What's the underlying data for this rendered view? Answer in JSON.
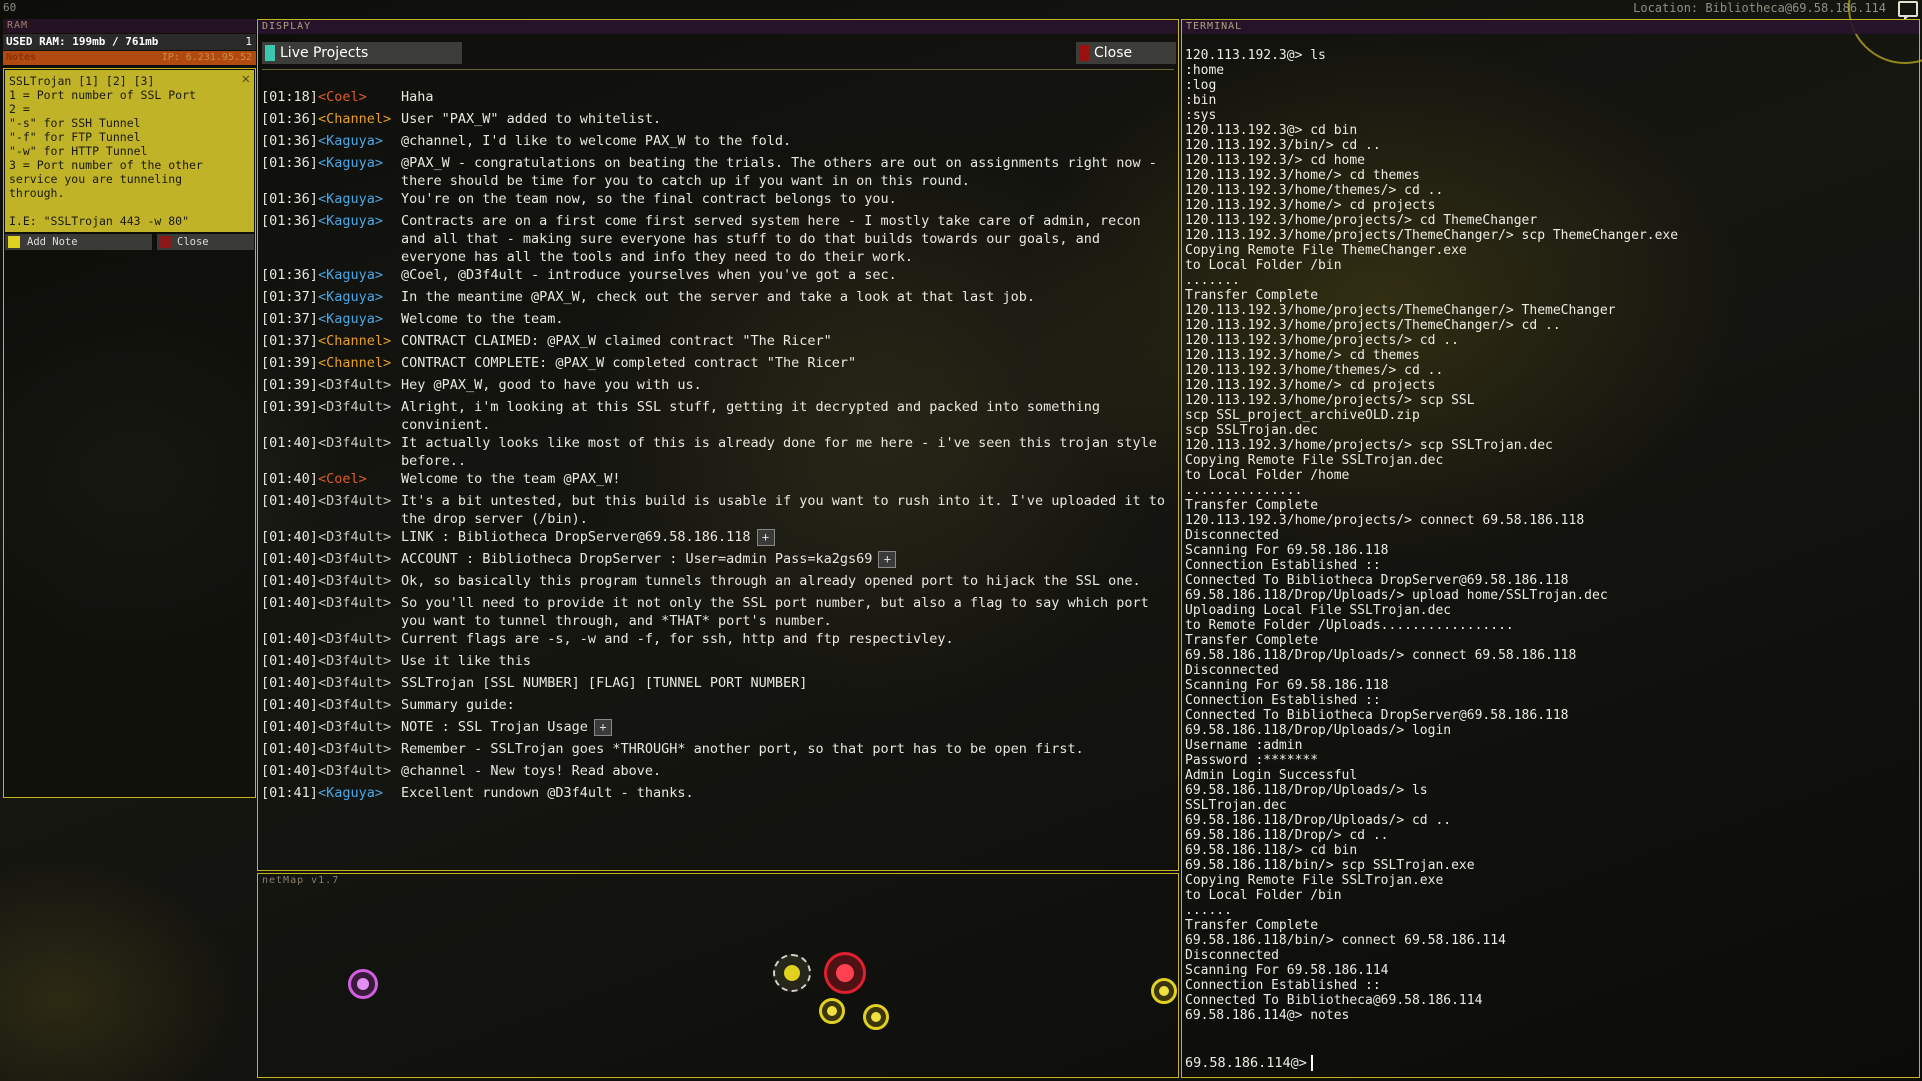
{
  "top": {
    "fps": "60",
    "location": "Location: Bibliotheca@69.58.186.114"
  },
  "ram": {
    "title": "RAM",
    "used_label": "USED RAM: 199mb / 761mb",
    "count": "1",
    "notes_label": "Notes",
    "ip": "IP: 6.231.95.52"
  },
  "note": {
    "lines": [
      "SSLTrojan [1] [2] [3]",
      "1 = Port number of SSL Port",
      "2 =",
      "\"-s\" for SSH Tunnel",
      "\"-f\" for FTP Tunnel",
      "\"-w\" for HTTP Tunnel",
      "3 = Port number of the other",
      "service you are tunneling",
      "through.",
      "",
      "I.E: \"SSLTrojan 443 -w 80\""
    ],
    "add_label": "Add Note",
    "close_label": "Close"
  },
  "display": {
    "title": "DISPLAY",
    "tab_label": "Live Projects",
    "close_label": "Close",
    "messages": [
      {
        "ts": "[01:18]",
        "who": "<Coel>",
        "cls": "c-coel",
        "text": "Haha"
      },
      {
        "ts": "[01:36]",
        "who": "<Channel>",
        "cls": "c-channel",
        "text": "User \"PAX_W\" added to whitelist."
      },
      {
        "ts": "[01:36]",
        "who": "<Kaguya>",
        "cls": "c-kaguya",
        "text": "@channel, I'd like to welcome PAX_W to the fold."
      },
      {
        "ts": "[01:36]",
        "who": "<Kaguya>",
        "cls": "c-kaguya",
        "text": "@PAX_W - congratulations on beating the trials. The others are out on assignments right now - there should be time for you to catch up if you want in on this round."
      },
      {
        "ts": "[01:36]",
        "who": "<Kaguya>",
        "cls": "c-kaguya",
        "text": "You're on the team now, so the final contract belongs to you."
      },
      {
        "ts": "[01:36]",
        "who": "<Kaguya>",
        "cls": "c-kaguya",
        "text": "Contracts are on a first come first served system here - I mostly take care of admin, recon and all that - making sure everyone has stuff to do that builds towards our goals, and everyone has all the tools and info they need to do their work."
      },
      {
        "ts": "[01:36]",
        "who": "<Kaguya>",
        "cls": "c-kaguya",
        "text": "@Coel, @D3f4ult - introduce yourselves when you've got a sec."
      },
      {
        "ts": "[01:37]",
        "who": "<Kaguya>",
        "cls": "c-kaguya",
        "text": "In the meantime @PAX_W, check out the server and take a look at that last job."
      },
      {
        "ts": "[01:37]",
        "who": "<Kaguya>",
        "cls": "c-kaguya",
        "text": "Welcome to the team."
      },
      {
        "ts": "[01:37]",
        "who": "<Channel>",
        "cls": "c-channel",
        "text": "CONTRACT CLAIMED: @PAX_W claimed contract \"The Ricer\""
      },
      {
        "ts": "[01:39]",
        "who": "<Channel>",
        "cls": "c-channel",
        "text": "CONTRACT COMPLETE: @PAX_W completed contract \"The Ricer\""
      },
      {
        "ts": "[01:39]",
        "who": "<D3f4ult>",
        "cls": "c-d3f4ult",
        "text": "Hey @PAX_W, good to have you with us."
      },
      {
        "ts": "[01:39]",
        "who": "<D3f4ult>",
        "cls": "c-d3f4ult",
        "text": "Alright, i'm looking at this SSL stuff, getting it decrypted and packed into something convinient."
      },
      {
        "ts": "[01:40]",
        "who": "<D3f4ult>",
        "cls": "c-d3f4ult",
        "text": "It actually looks like most of this is already done for me here - i've seen this trojan style before.."
      },
      {
        "ts": "[01:40]",
        "who": "<Coel>",
        "cls": "c-coel",
        "text": "Welcome to the team @PAX_W!"
      },
      {
        "ts": "[01:40]",
        "who": "<D3f4ult>",
        "cls": "c-d3f4ult",
        "text": "It's a bit untested, but this build is usable if you want to rush into it. I've uploaded it to the drop server (/bin)."
      },
      {
        "ts": "[01:40]",
        "who": "<D3f4ult>",
        "cls": "c-d3f4ult",
        "text": "LINK : Bibliotheca DropServer@69.58.186.118",
        "plus": "+"
      },
      {
        "ts": "[01:40]",
        "who": "<D3f4ult>",
        "cls": "c-d3f4ult",
        "text": "ACCOUNT : Bibliotheca DropServer : User=admin Pass=ka2gs69",
        "plus": "+"
      },
      {
        "ts": "[01:40]",
        "who": "<D3f4ult>",
        "cls": "c-d3f4ult",
        "text": "Ok, so basically this program tunnels through an already opened port to hijack the SSL one."
      },
      {
        "ts": "[01:40]",
        "who": "<D3f4ult>",
        "cls": "c-d3f4ult",
        "text": "So you'll need to provide it not only the SSL port number, but also a flag to say which port you want to tunnel through, and *THAT* port's number."
      },
      {
        "ts": "[01:40]",
        "who": "<D3f4ult>",
        "cls": "c-d3f4ult",
        "text": "Current flags are -s, -w and -f, for ssh, http and ftp respectivley."
      },
      {
        "ts": "[01:40]",
        "who": "<D3f4ult>",
        "cls": "c-d3f4ult",
        "text": "Use it like this"
      },
      {
        "ts": "[01:40]",
        "who": "<D3f4ult>",
        "cls": "c-d3f4ult",
        "text": "SSLTrojan [SSL NUMBER] [FLAG] [TUNNEL PORT NUMBER]"
      },
      {
        "ts": "[01:40]",
        "who": "<D3f4ult>",
        "cls": "c-d3f4ult",
        "text": "Summary guide:"
      },
      {
        "ts": "[01:40]",
        "who": "<D3f4ult>",
        "cls": "c-d3f4ult",
        "text": "NOTE : SSL Trojan Usage",
        "plus": "+"
      },
      {
        "ts": "[01:40]",
        "who": "<D3f4ult>",
        "cls": "c-d3f4ult",
        "text": "Remember - SSLTrojan goes *THROUGH* another port, so that port has to be open first."
      },
      {
        "ts": "[01:40]",
        "who": "<D3f4ult>",
        "cls": "c-d3f4ult",
        "text": "@channel - New toys! Read above."
      },
      {
        "ts": "[01:41]",
        "who": "<Kaguya>",
        "cls": "c-kaguya",
        "text": "Excellent rundown @D3f4ult - thanks."
      }
    ]
  },
  "netmap": {
    "title": "netMap v1.7"
  },
  "terminal": {
    "title": "TERMINAL",
    "lines": [
      "120.113.192.3@> ls",
      ":home",
      ":log",
      ":bin",
      ":sys",
      "120.113.192.3@> cd bin",
      "120.113.192.3/bin/> cd ..",
      "120.113.192.3/> cd home",
      "120.113.192.3/home/> cd themes",
      "120.113.192.3/home/themes/> cd ..",
      "120.113.192.3/home/> cd projects",
      "120.113.192.3/home/projects/> cd ThemeChanger",
      "120.113.192.3/home/projects/ThemeChanger/> scp ThemeChanger.exe",
      "Copying Remote File ThemeChanger.exe",
      "to Local Folder /bin",
      ".......",
      "Transfer Complete",
      "120.113.192.3/home/projects/ThemeChanger/> ThemeChanger",
      "120.113.192.3/home/projects/ThemeChanger/> cd ..",
      "120.113.192.3/home/projects/> cd ..",
      "120.113.192.3/home/> cd themes",
      "120.113.192.3/home/themes/> cd ..",
      "120.113.192.3/home/> cd projects",
      "120.113.192.3/home/projects/> scp SSL",
      "scp SSL_project_archiveOLD.zip",
      "scp SSLTrojan.dec",
      "120.113.192.3/home/projects/> scp SSLTrojan.dec",
      "Copying Remote File SSLTrojan.dec",
      "to Local Folder /home",
      "...............",
      "Transfer Complete",
      "120.113.192.3/home/projects/> connect 69.58.186.118",
      "Disconnected",
      "Scanning For 69.58.186.118",
      "Connection Established ::",
      "Connected To Bibliotheca DropServer@69.58.186.118",
      "69.58.186.118/Drop/Uploads/> upload home/SSLTrojan.dec",
      "Uploading Local File SSLTrojan.dec",
      "to Remote Folder /Uploads.................",
      "Transfer Complete",
      "69.58.186.118/Drop/Uploads/> connect 69.58.186.118",
      "Disconnected",
      "Scanning For 69.58.186.118",
      "Connection Established ::",
      "Connected To Bibliotheca DropServer@69.58.186.118",
      "69.58.186.118/Drop/Uploads/> login",
      "Username :admin",
      "Password :*******",
      "Admin Login Successful",
      "69.58.186.118/Drop/Uploads/> ls",
      "SSLTrojan.dec",
      "69.58.186.118/Drop/Uploads/> cd ..",
      "69.58.186.118/Drop/> cd ..",
      "69.58.186.118/> cd bin",
      "69.58.186.118/bin/> scp SSLTrojan.exe",
      "Copying Remote File SSLTrojan.exe",
      "to Local Folder /bin",
      "......",
      "Transfer Complete",
      "69.58.186.118/bin/> connect 69.58.186.114",
      "Disconnected",
      "Scanning For 69.58.186.114",
      "Connection Established ::",
      "Connected To Bibliotheca@69.58.186.114",
      "69.58.186.114@> notes"
    ],
    "prompt": "69.58.186.114@>"
  }
}
